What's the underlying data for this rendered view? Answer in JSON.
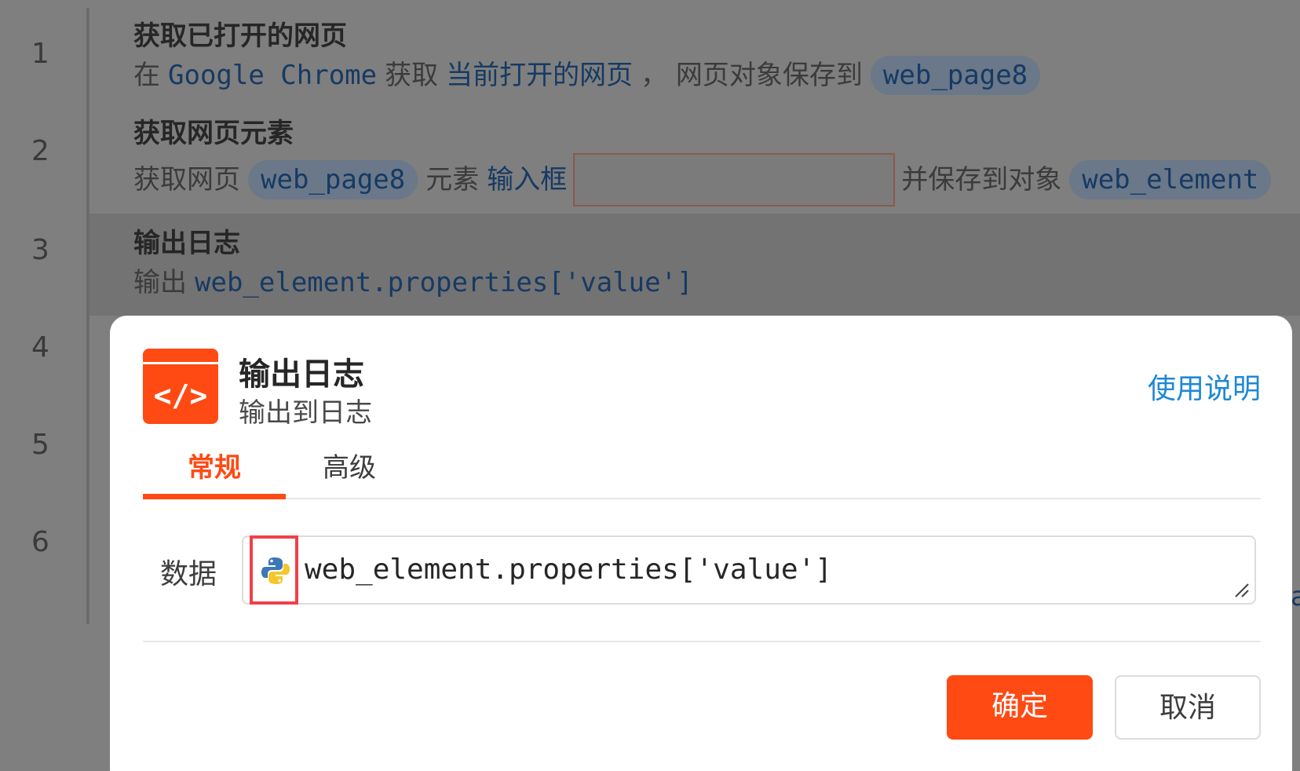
{
  "gutter": {
    "line_numbers": [
      "1",
      "2",
      "3",
      "4",
      "5",
      "6"
    ]
  },
  "steps": [
    {
      "title": "获取已打开的网页",
      "parts": {
        "t1": "在",
        "browser": "Google Chrome",
        "t2": "获取",
        "target": "当前打开的网页",
        "t3": "， 网页对象保存到",
        "var": "web_page8"
      }
    },
    {
      "title": "获取网页元素",
      "parts": {
        "t1": "获取网页",
        "var": "web_page8",
        "t2": "元素",
        "element_type": "输入框",
        "t3": "并保存到对象",
        "out_var": "web_element"
      }
    },
    {
      "title": "输出日志",
      "parts": {
        "t1": "输出",
        "expr": "web_element.properties['value']"
      }
    }
  ],
  "dialog": {
    "title": "输出日志",
    "subtitle": "输出到日志",
    "help_link": "使用说明",
    "tabs": [
      {
        "label": "常规",
        "active": true
      },
      {
        "label": "高级",
        "active": false
      }
    ],
    "field": {
      "label": "数据",
      "value": "web_element.properties['value']",
      "mode_icon": "python-icon"
    },
    "buttons": {
      "ok": "确定",
      "cancel": "取消"
    }
  },
  "background_fragment": "a",
  "colors": {
    "accent": "#ff4a14",
    "link": "#1e88d6",
    "variable_pill": "#6a7889",
    "highlight_box": "#f0404a"
  }
}
